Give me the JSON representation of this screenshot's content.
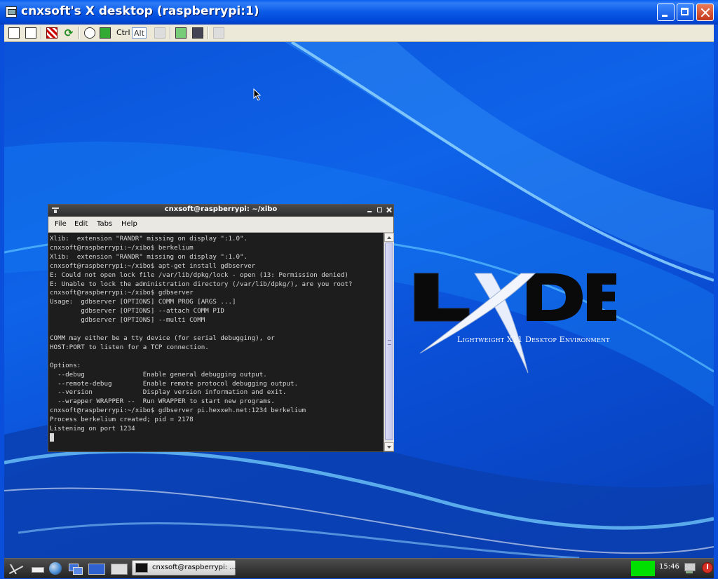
{
  "vnc": {
    "title": "cnxsoft's X desktop (raspberrypi:1)",
    "toolbar_ctrl": "Ctrl",
    "toolbar_alt": "Alt"
  },
  "terminal": {
    "title": "cnxsoft@raspberrypi: ~/xibo",
    "menu": [
      "File",
      "Edit",
      "Tabs",
      "Help"
    ],
    "output": "Xlib:  extension \"RANDR\" missing on display \":1.0\".\ncnxsoft@raspberrypi:~/xibo$ berkelium\nXlib:  extension \"RANDR\" missing on display \":1.0\".\ncnxsoft@raspberrypi:~/xibo$ apt-get install gdbserver\nE: Could not open lock file /var/lib/dpkg/lock - open (13: Permission denied)\nE: Unable to lock the administration directory (/var/lib/dpkg/), are you root?\ncnxsoft@raspberrypi:~/xibo$ gdbserver\nUsage:  gdbserver [OPTIONS] COMM PROG [ARGS ...]\n        gdbserver [OPTIONS] --attach COMM PID\n        gdbserver [OPTIONS] --multi COMM\n\nCOMM may either be a tty device (for serial debugging), or\nHOST:PORT to listen for a TCP connection.\n\nOptions:\n  --debug               Enable general debugging output.\n  --remote-debug        Enable remote protocol debugging output.\n  --version             Display version information and exit.\n  --wrapper WRAPPER --  Run WRAPPER to start new programs.\ncnxsoft@raspberrypi:~/xibo$ gdbserver pi.hexxeh.net:1234 berkelium\nProcess berkelium created; pid = 2178\nListening on port 1234"
  },
  "wallpaper": {
    "logo_text": "LXDE",
    "tagline": "Lightweight X11 Desktop Environment"
  },
  "panel": {
    "task_label": "cnxsoft@raspberrypi: ...",
    "clock": "15:46"
  },
  "colors": {
    "xp_title_blue": "#0a59e6",
    "desktop_blue": "#0b53d8",
    "terminal_bg": "#1d1d1d",
    "cpu_monitor_green": "#00e000"
  }
}
